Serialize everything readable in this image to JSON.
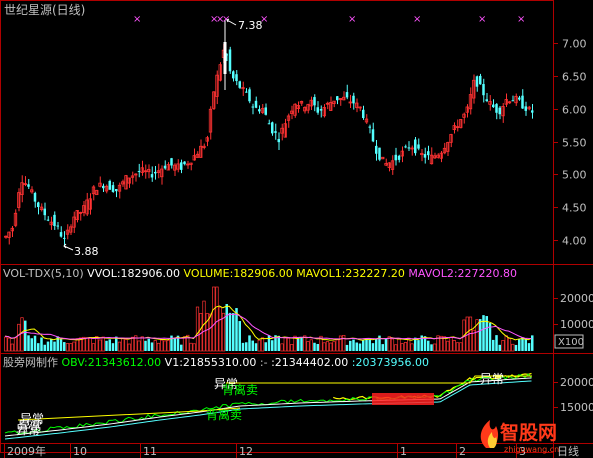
{
  "header": {
    "title": "世纪星源(日线)"
  },
  "colors": {
    "bg": "#000000",
    "frame": "#b00000",
    "up": "#ff3232",
    "down": "#54ffff",
    "grid": "#800000",
    "axis_text": "#c0c0c0",
    "white": "#ffffff",
    "yellow": "#ffff00",
    "magenta": "#ff55ff",
    "green": "#00ff00",
    "cyan": "#54ffff"
  },
  "price_panel": {
    "y_ticks": [
      "7.00",
      "6.50",
      "6.00",
      "5.50",
      "5.00",
      "4.50",
      "4.00"
    ],
    "high_label": "7.38",
    "low_label": "3.88",
    "marker_glyph": "×"
  },
  "volume_panel": {
    "legend": [
      {
        "text": "VOL-TDX(5,10)",
        "color": "#c0c0c0"
      },
      {
        "text": "VVOL:182906.00",
        "color": "#ffffff"
      },
      {
        "text": "VOLUME:182906.00",
        "color": "#ffff00"
      },
      {
        "text": "MAVOL1:232227.20",
        "color": "#ffff00"
      },
      {
        "text": "MAVOL2:227220.80",
        "color": "#ff55ff"
      }
    ],
    "y_ticks": [
      "20000",
      "10000"
    ],
    "unit_label": "X100"
  },
  "obv_panel": {
    "legend": [
      {
        "text": "股旁网制作",
        "color": "#c0c0c0"
      },
      {
        "text": "OBV:21343612.00",
        "color": "#00ff00"
      },
      {
        "text": "V1:21855310.00",
        "color": "#ffffff"
      },
      {
        "text": ":-",
        "color": "#c0c0c0"
      },
      {
        "text": ":21344402.00",
        "color": "#ffffff"
      },
      {
        "text": ":20373956.00",
        "color": "#54ffff"
      }
    ],
    "y_ticks": [
      "20000",
      "15000"
    ],
    "signals": [
      {
        "text": "异常",
        "color": "#ffffff"
      },
      {
        "text": "异常",
        "color": "#ffffff"
      },
      {
        "text": "异常",
        "color": "#ffffff"
      },
      {
        "text": "异常",
        "color": "#ffffff"
      },
      {
        "text": "背离卖",
        "color": "#00ff00"
      },
      {
        "text": "背离卖",
        "color": "#00ff00"
      },
      {
        "text": "异常",
        "color": "#ffffff"
      }
    ]
  },
  "x_axis": {
    "labels": [
      "2009年",
      "10",
      "11",
      "12",
      "1",
      "2",
      "3"
    ],
    "period": "日线"
  },
  "watermark": {
    "text": "智股网",
    "sub": "zhiguwang.cn"
  }
}
